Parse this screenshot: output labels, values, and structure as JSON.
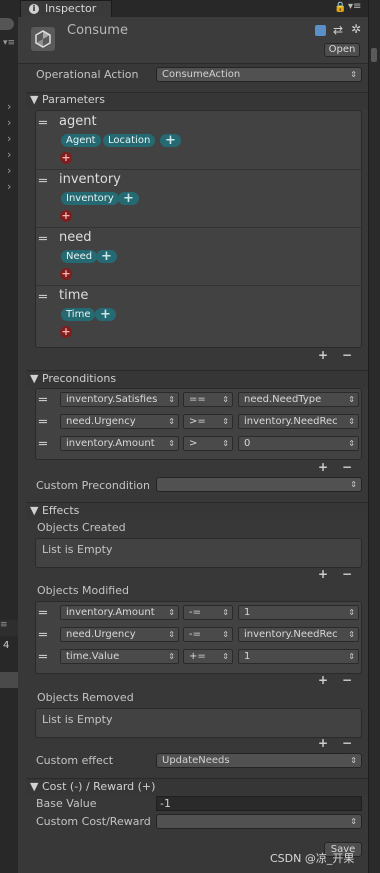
{
  "tab": {
    "title": "Inspector"
  },
  "header": {
    "title": "Consume",
    "open_label": "Open"
  },
  "operational_action": {
    "label": "Operational Action",
    "value": "ConsumeAction"
  },
  "parameters": {
    "title": "Parameters",
    "items": [
      {
        "name": "agent",
        "chips": [
          "Agent",
          "Location"
        ]
      },
      {
        "name": "inventory",
        "chips": [
          "Inventory"
        ]
      },
      {
        "name": "need",
        "chips": [
          "Need"
        ]
      },
      {
        "name": "time",
        "chips": [
          "Time"
        ]
      }
    ]
  },
  "preconditions": {
    "title": "Preconditions",
    "rows": [
      {
        "left": "inventory.Satisfies",
        "op": "==",
        "right": "need.NeedType"
      },
      {
        "left": "need.Urgency",
        "op": ">=",
        "right": "inventory.NeedRec"
      },
      {
        "left": "inventory.Amount",
        "op": ">",
        "right": "0"
      }
    ],
    "custom_label": "Custom Precondition",
    "custom_value": ""
  },
  "effects": {
    "title": "Effects",
    "created_label": "Objects Created",
    "created_empty": "List is Empty",
    "modified_label": "Objects Modified",
    "modified_rows": [
      {
        "left": "inventory.Amount",
        "op": "-=",
        "right": "1"
      },
      {
        "left": "need.Urgency",
        "op": "-=",
        "right": "inventory.NeedRec"
      },
      {
        "left": "time.Value",
        "op": "+=",
        "right": "1"
      }
    ],
    "removed_label": "Objects Removed",
    "removed_empty": "List is Empty",
    "custom_label": "Custom effect",
    "custom_value": "UpdateNeeds"
  },
  "cost": {
    "title": "Cost (-) / Reward (+)",
    "base_label": "Base Value",
    "base_value": "-1",
    "custom_label": "Custom Cost/Reward",
    "custom_value": ""
  },
  "save_label": "Save",
  "left_panel": {
    "count": "4"
  },
  "watermark": "CSDN @凉_开果"
}
